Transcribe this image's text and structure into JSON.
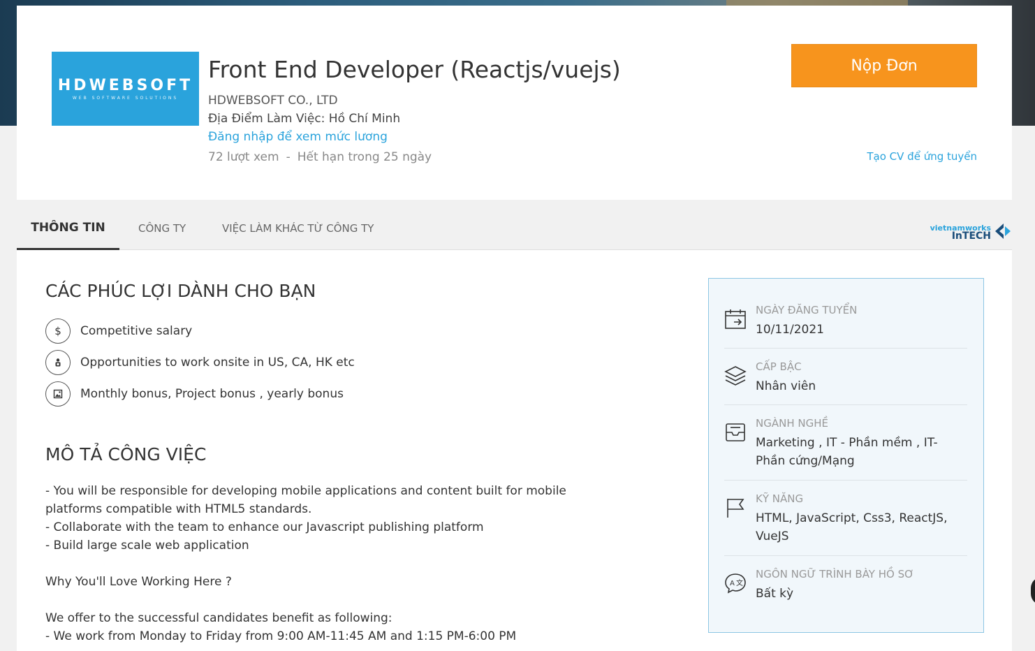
{
  "header": {
    "logo_text": "HDWEBSOFT",
    "logo_sub": "WEB SOFTWARE SOLUTIONS",
    "job_title": "Front End Developer (Reactjs/vuejs)",
    "company": "HDWEBSOFT CO., LTD",
    "location": "Địa Điểm Làm Việc: Hồ Chí Minh",
    "salary_link": "Đăng nhập để xem mức lương",
    "views": "72 lượt xem",
    "separator": "-",
    "expires": "Hết hạn trong 25 ngày",
    "apply_label": "Nộp Đơn",
    "create_cv_label": "Tạo CV để ứng tuyển"
  },
  "tabs": [
    {
      "label": "THÔNG TIN",
      "active": true
    },
    {
      "label": "CÔNG TY",
      "active": false
    },
    {
      "label": "VIỆC LÀM KHÁC TỪ CÔNG TY",
      "active": false
    }
  ],
  "partner": {
    "line1": "vietnamworks",
    "line2": "InTECH"
  },
  "benefits": {
    "title": "CÁC PHÚC LỢI DÀNH CHO BẠN",
    "items": [
      {
        "icon": "dollar-icon",
        "text": "Competitive salary"
      },
      {
        "icon": "traveler-icon",
        "text": "Opportunities to work onsite in US, CA, HK etc"
      },
      {
        "icon": "picture-icon",
        "text": "Monthly bonus, Project bonus , yearly bonus"
      }
    ]
  },
  "description": {
    "title": "MÔ TẢ CÔNG VIỆC",
    "lines": [
      "- You will be responsible for developing mobile applications and content built for mobile platforms compatible with HTML5 standards.",
      "- Collaborate with the team to enhance our Javascript publishing platform",
      "- Build large scale web application",
      " ",
      "Why You'll Love Working Here ?",
      " ",
      "We offer to the successful candidates benefit as following:",
      "- We work from Monday to Friday from 9:00 AM-11:45 AM and 1:15 PM-6:00 PM"
    ]
  },
  "sidebar": [
    {
      "icon": "calendar-icon",
      "label": "NGÀY ĐĂNG TUYỂN",
      "value": "10/11/2021"
    },
    {
      "icon": "layers-icon",
      "label": "CẤP BẬC",
      "value": "Nhân viên"
    },
    {
      "icon": "inbox-icon",
      "label": "NGÀNH NGHỀ",
      "value": "Marketing ,  IT - Phần mềm ,  IT-Phần cứng/Mạng"
    },
    {
      "icon": "flag-icon",
      "label": "KỸ NĂNG",
      "value": "HTML, JavaScript, Css3, ReactJS, VueJS"
    },
    {
      "icon": "translate-icon",
      "label": "NGÔN NGỮ TRÌNH BÀY HỒ SƠ",
      "value": "Bất kỳ"
    }
  ]
}
